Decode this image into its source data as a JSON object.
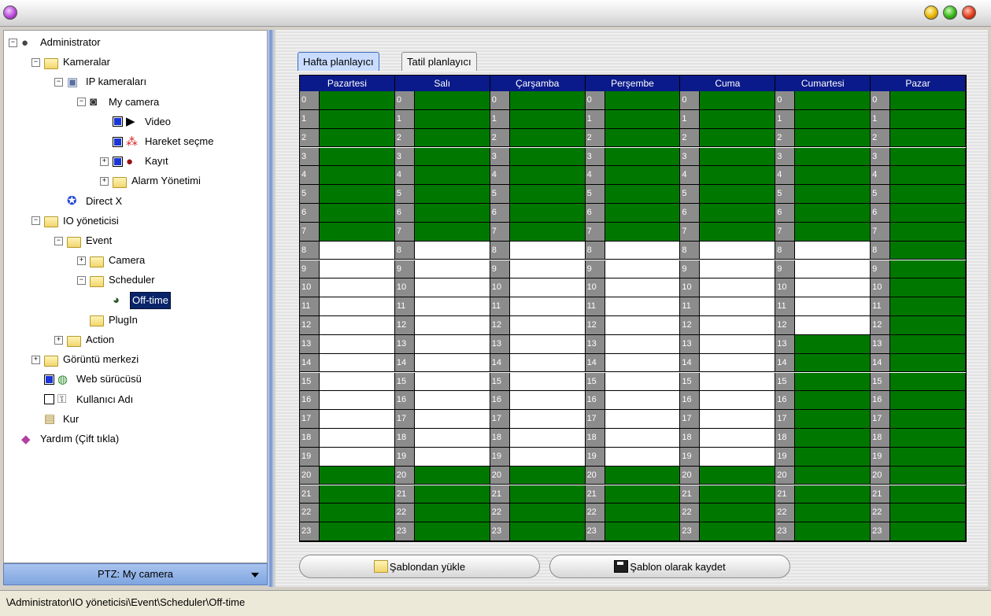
{
  "window": {
    "title": ""
  },
  "tree": {
    "items": [
      {
        "id": "admin",
        "label": "Administrator",
        "level": 0,
        "expander": "−",
        "icon": "user-icon"
      },
      {
        "id": "kameralar",
        "label": "Kameralar",
        "level": 1,
        "expander": "−",
        "icon": "folder-open-icon"
      },
      {
        "id": "ipcam",
        "label": "IP kameraları",
        "level": 2,
        "expander": "−",
        "icon": "network-camera-icon"
      },
      {
        "id": "mycamera",
        "label": "My camera",
        "level": 3,
        "expander": "−",
        "icon": "camera-icon"
      },
      {
        "id": "video",
        "label": "Video",
        "level": 4,
        "check": true,
        "icon": "play-icon"
      },
      {
        "id": "hareket",
        "label": "Hareket seçme",
        "level": 4,
        "check": true,
        "icon": "motion-icon"
      },
      {
        "id": "kayit",
        "label": "Kayıt",
        "level": 4,
        "check": true,
        "expander": "+",
        "icon": "record-icon"
      },
      {
        "id": "alarm",
        "label": "Alarm Yönetimi",
        "level": 4,
        "expander": "+",
        "icon": "folder-icon"
      },
      {
        "id": "directx",
        "label": "Direct X",
        "level": 2,
        "icon": "directx-icon"
      },
      {
        "id": "io",
        "label": "IO yöneticisi",
        "level": 1,
        "expander": "−",
        "icon": "folder-open-icon"
      },
      {
        "id": "event",
        "label": "Event",
        "level": 2,
        "expander": "−",
        "icon": "folder-open-icon"
      },
      {
        "id": "camera",
        "label": "Camera",
        "level": 3,
        "expander": "+",
        "icon": "folder-icon"
      },
      {
        "id": "scheduler",
        "label": "Scheduler",
        "level": 3,
        "expander": "−",
        "icon": "folder-open-icon"
      },
      {
        "id": "offtime",
        "label": "Off-time",
        "level": 4,
        "icon": "clock-icon",
        "selected": true
      },
      {
        "id": "plugin",
        "label": "PlugIn",
        "level": 3,
        "icon": "folder-icon"
      },
      {
        "id": "action",
        "label": "Action",
        "level": 2,
        "expander": "+",
        "icon": "folder-icon"
      },
      {
        "id": "goruntu",
        "label": "Görüntü merkezi",
        "level": 1,
        "expander": "+",
        "icon": "folder-icon"
      },
      {
        "id": "web",
        "label": "Web sürücüsü",
        "level": 1,
        "check": true,
        "icon": "globe-icon"
      },
      {
        "id": "kullanici",
        "label": "Kullanıcı Adı",
        "level": 1,
        "check": false,
        "icon": "key-icon"
      },
      {
        "id": "kur",
        "label": "Kur",
        "level": 1,
        "icon": "setup-icon"
      },
      {
        "id": "yardim",
        "label": "Yardım (Çift tıkla)",
        "level": 0,
        "icon": "help-book-icon"
      }
    ]
  },
  "ptz": {
    "label": "PTZ: My camera"
  },
  "tabs": [
    {
      "label": "Hafta planlayıcı",
      "active": true
    },
    {
      "label": "Tatil planlayıcı",
      "active": false
    }
  ],
  "schedule": {
    "days": [
      "Pazartesi",
      "Salı",
      "Çarşamba",
      "Perşembe",
      "Cuma",
      "Cumartesi",
      "Pazar"
    ],
    "hours": [
      "0",
      "1",
      "2",
      "3",
      "4",
      "5",
      "6",
      "7",
      "8",
      "9",
      "10",
      "11",
      "12",
      "13",
      "14",
      "15",
      "16",
      "17",
      "18",
      "19",
      "20",
      "21",
      "22",
      "23"
    ],
    "off_ranges": [
      [
        8,
        19
      ],
      [
        8,
        19
      ],
      [
        8,
        19
      ],
      [
        8,
        19
      ],
      [
        8,
        19
      ],
      [
        8,
        12
      ],
      null
    ],
    "colors": {
      "active": "#007800",
      "inactive": "#ffffff",
      "header": "#0a1a8a",
      "hour": "#8c8c8c"
    }
  },
  "buttons": {
    "load_template": "Şablondan yükle",
    "save_template": "Şablon olarak kaydet"
  },
  "status": {
    "path": "\\Administrator\\IO yöneticisi\\Event\\Scheduler\\Off-time"
  }
}
